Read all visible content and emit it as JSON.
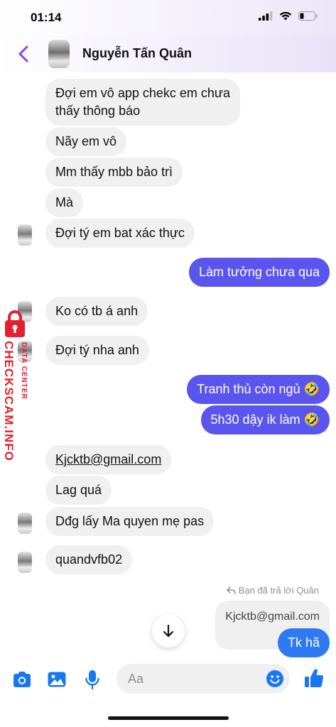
{
  "status_bar": {
    "time": "01:14"
  },
  "header": {
    "contact_name": "Nguyễn Tấn Quân"
  },
  "messages": [
    {
      "text": "Đợi em vô app chekc em chưa thấy thông báo",
      "line1": "Đợi em vô app chekc em chưa",
      "line2": "thấy thông báo",
      "side": "incoming"
    },
    {
      "text": "Nãy em vô",
      "side": "incoming"
    },
    {
      "text": "Mm thấy mbb bảo trì",
      "side": "incoming"
    },
    {
      "text": "Mà",
      "side": "incoming"
    },
    {
      "text": "Đợi tý em bat xác thực",
      "side": "incoming"
    },
    {
      "text": "Làm tưởng chưa qua",
      "side": "outgoing"
    },
    {
      "text": "Ko có tb á anh",
      "side": "incoming"
    },
    {
      "text": "Đợi tý nha anh",
      "side": "incoming"
    },
    {
      "text": "Tranh thủ còn ngủ 🤣",
      "side": "outgoing"
    },
    {
      "text": "5h30 dậy ik làm 🤣",
      "side": "outgoing"
    },
    {
      "text": "Kjcktb@gmail.com",
      "side": "incoming"
    },
    {
      "text": "Lag quá",
      "side": "incoming"
    },
    {
      "text": "Dđg lấy Ma quyen mẹ pas",
      "side": "incoming"
    },
    {
      "text": "quandvfb02",
      "side": "incoming"
    },
    {
      "text": "Kjcktb@gmail.com",
      "side": "quoted-reply"
    },
    {
      "text": "Tk hã",
      "side": "outgoing"
    }
  ],
  "reply_note": "Bạn đã trả lời Quân",
  "watermark": {
    "main": "CHECKSCAM.INFO",
    "sub": "DATA CENTER"
  },
  "composer": {
    "placeholder": "Aa"
  },
  "colors": {
    "outgoing": "#5b55f0",
    "outgoing_blue": "#2f7af2",
    "incoming": "#f0f0f0",
    "accent": "#8a3ffc",
    "watermark": "#e3202b"
  }
}
